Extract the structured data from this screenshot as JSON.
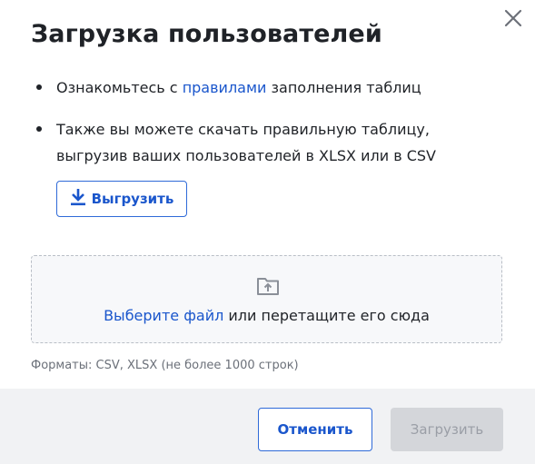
{
  "dialog": {
    "title": "Загрузка пользователей",
    "close_icon": "close-icon"
  },
  "bullets": {
    "first": {
      "before": "Ознакомьтесь с ",
      "link": "правилами",
      "after": " заполнения таблиц"
    },
    "second": {
      "text": "Также вы можете скачать правильную таблицу, выгрузив ваших пользователей в XLSX или в CSV"
    }
  },
  "export_button": {
    "label": "Выгрузить",
    "icon": "download-icon"
  },
  "dropzone": {
    "icon": "folder-upload-icon",
    "link": "Выберите файл",
    "text": " или перетащите его сюда"
  },
  "formats_hint": "Форматы: CSV, XLSX (не более 1000 строк)",
  "footer": {
    "cancel_label": "Отменить",
    "upload_label": "Загрузить",
    "upload_enabled": false
  },
  "colors": {
    "accent": "#1a56cc",
    "text": "#1f2227",
    "muted": "#6b7079",
    "footer_bg": "#f1f2f4",
    "disabled_bg": "#d4d6da"
  }
}
